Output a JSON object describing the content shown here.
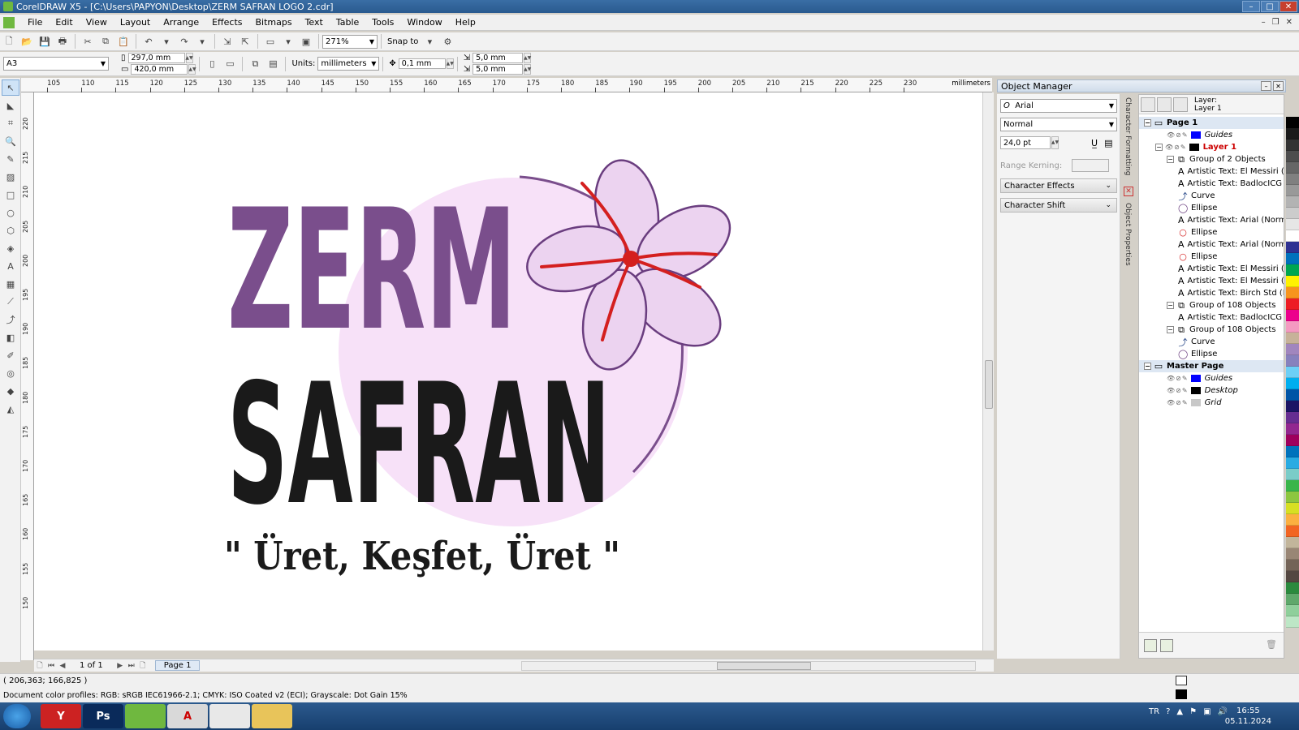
{
  "titlebar": {
    "title": "CorelDRAW X5 - [C:\\Users\\PAPYON\\Desktop\\ZERM SAFRAN LOGO 2.cdr]"
  },
  "menu": {
    "items": [
      "File",
      "Edit",
      "View",
      "Layout",
      "Arrange",
      "Effects",
      "Bitmaps",
      "Text",
      "Table",
      "Tools",
      "Window",
      "Help"
    ]
  },
  "toolbar1": {
    "zoom": "271%",
    "snap_label": "Snap to"
  },
  "toolbar2": {
    "page_size": "A3",
    "width": "297,0 mm",
    "height": "420,0 mm",
    "units_label": "Units:",
    "units_value": "millimeters",
    "nudge": "0,1 mm",
    "dup_x": "5,0 mm",
    "dup_y": "5,0 mm"
  },
  "ruler": {
    "unit": "millimeters",
    "h_ticks": [
      "105",
      "110",
      "115",
      "120",
      "125",
      "130",
      "135",
      "140",
      "145",
      "150",
      "155",
      "160",
      "165",
      "170",
      "175",
      "180",
      "185",
      "190",
      "195",
      "200",
      "205",
      "210",
      "215",
      "220",
      "225",
      "230"
    ],
    "v_ticks": [
      "220",
      "215",
      "210",
      "205",
      "200",
      "195",
      "190",
      "185",
      "180",
      "175",
      "170",
      "165",
      "160",
      "155",
      "150"
    ]
  },
  "logo": {
    "word1": "ZERM",
    "word2": "SAFRAN",
    "slogan": "\" Üret, Keşfet, Üret \"",
    "purple": "#7a4e8c",
    "dark": "#1a1a1a",
    "circle": "#f7e1f8",
    "petal": "#ecd3f0",
    "stamen": "#d41f1f"
  },
  "pagenav": {
    "page_count": "1 of 1",
    "tab": "Page 1"
  },
  "docker": {
    "title": "Object Manager",
    "font": "Arial",
    "style": "Normal",
    "size": "24,0 pt",
    "range_kerning": "Range Kerning:",
    "sections": [
      "Character Effects",
      "Character Shift"
    ],
    "vtab1": "Character Formatting",
    "vtab2": "Object Properties"
  },
  "tree": {
    "layer_head_label": "Layer:",
    "layer_head_value": "Layer 1",
    "rows": [
      {
        "text": "Page 1",
        "kind": "page",
        "indent": 0
      },
      {
        "text": "Guides",
        "kind": "layer",
        "indent": 2,
        "swatch": "#0000ff",
        "italic": true
      },
      {
        "text": "Layer 1",
        "kind": "layer",
        "indent": 1,
        "swatch": "#000000",
        "red": true
      },
      {
        "text": "Group of 2 Objects",
        "kind": "group",
        "indent": 2
      },
      {
        "text": "Artistic Text: El Messiri (E",
        "kind": "text",
        "indent": 3
      },
      {
        "text": "Artistic Text: BadlocICG (",
        "kind": "text",
        "indent": 3
      },
      {
        "text": "Curve",
        "kind": "curve",
        "indent": 3
      },
      {
        "text": "Ellipse",
        "kind": "ellipse",
        "indent": 3
      },
      {
        "text": "Artistic Text: Arial (Norm",
        "kind": "text",
        "indent": 3
      },
      {
        "text": "Ellipse",
        "kind": "ellipse2",
        "indent": 3
      },
      {
        "text": "Artistic Text: Arial (Norm",
        "kind": "text",
        "indent": 3
      },
      {
        "text": "Ellipse",
        "kind": "ellipse2",
        "indent": 3
      },
      {
        "text": "Artistic Text: El Messiri (E",
        "kind": "text",
        "indent": 3
      },
      {
        "text": "Artistic Text: El Messiri (E",
        "kind": "text",
        "indent": 3
      },
      {
        "text": "Artistic Text: Birch Std (N",
        "kind": "text",
        "indent": 3
      },
      {
        "text": "Group of 108 Objects",
        "kind": "group",
        "indent": 2
      },
      {
        "text": "Artistic Text: BadlocICG (",
        "kind": "text",
        "indent": 3
      },
      {
        "text": "Group of 108 Objects",
        "kind": "group",
        "indent": 2
      },
      {
        "text": "Curve",
        "kind": "curve",
        "indent": 3
      },
      {
        "text": "Ellipse",
        "kind": "ellipse",
        "indent": 3
      },
      {
        "text": "Master Page",
        "kind": "page",
        "indent": 0
      },
      {
        "text": "Guides",
        "kind": "layer",
        "indent": 2,
        "swatch": "#0000ff",
        "italic": true
      },
      {
        "text": "Desktop",
        "kind": "layer",
        "indent": 2,
        "swatch": "#000000",
        "italic": true
      },
      {
        "text": "Grid",
        "kind": "layer",
        "indent": 2,
        "swatch": "#c8c8c8",
        "italic": true
      }
    ]
  },
  "palette": [
    "#000000",
    "#1a1a1a",
    "#333333",
    "#4d4d4d",
    "#666666",
    "#808080",
    "#999999",
    "#b3b3b3",
    "#cccccc",
    "#e6e6e6",
    "#ffffff",
    "#2e3192",
    "#0071bc",
    "#00a651",
    "#fff200",
    "#f7941d",
    "#ed1c24",
    "#ec008c",
    "#f49ac1",
    "#c7b299",
    "#a186be",
    "#8781bd",
    "#6dcff6",
    "#00aeef",
    "#0054a6",
    "#1b1464",
    "#662d91",
    "#92278f",
    "#9e005d",
    "#0072bc",
    "#29abe2",
    "#7accc8",
    "#39b54a",
    "#8dc63f",
    "#d7df23",
    "#fbb040",
    "#f26522",
    "#c2b59b",
    "#998675",
    "#736357",
    "#534741",
    "#2b8a3e",
    "#5fa86b",
    "#8fcf9b",
    "#bde7c6"
  ],
  "status": {
    "coords": "( 206,363; 166,825 )",
    "profiles": "Document color profiles: RGB: sRGB IEC61966-2.1; CMYK: ISO Coated v2 (ECI); Grayscale: Dot Gain 15%"
  },
  "taskbar": {
    "lang": "TR",
    "time": "16:55",
    "date": "05.11.2024",
    "apps": [
      "Y",
      "Ps",
      "",
      "A",
      "",
      ""
    ]
  }
}
